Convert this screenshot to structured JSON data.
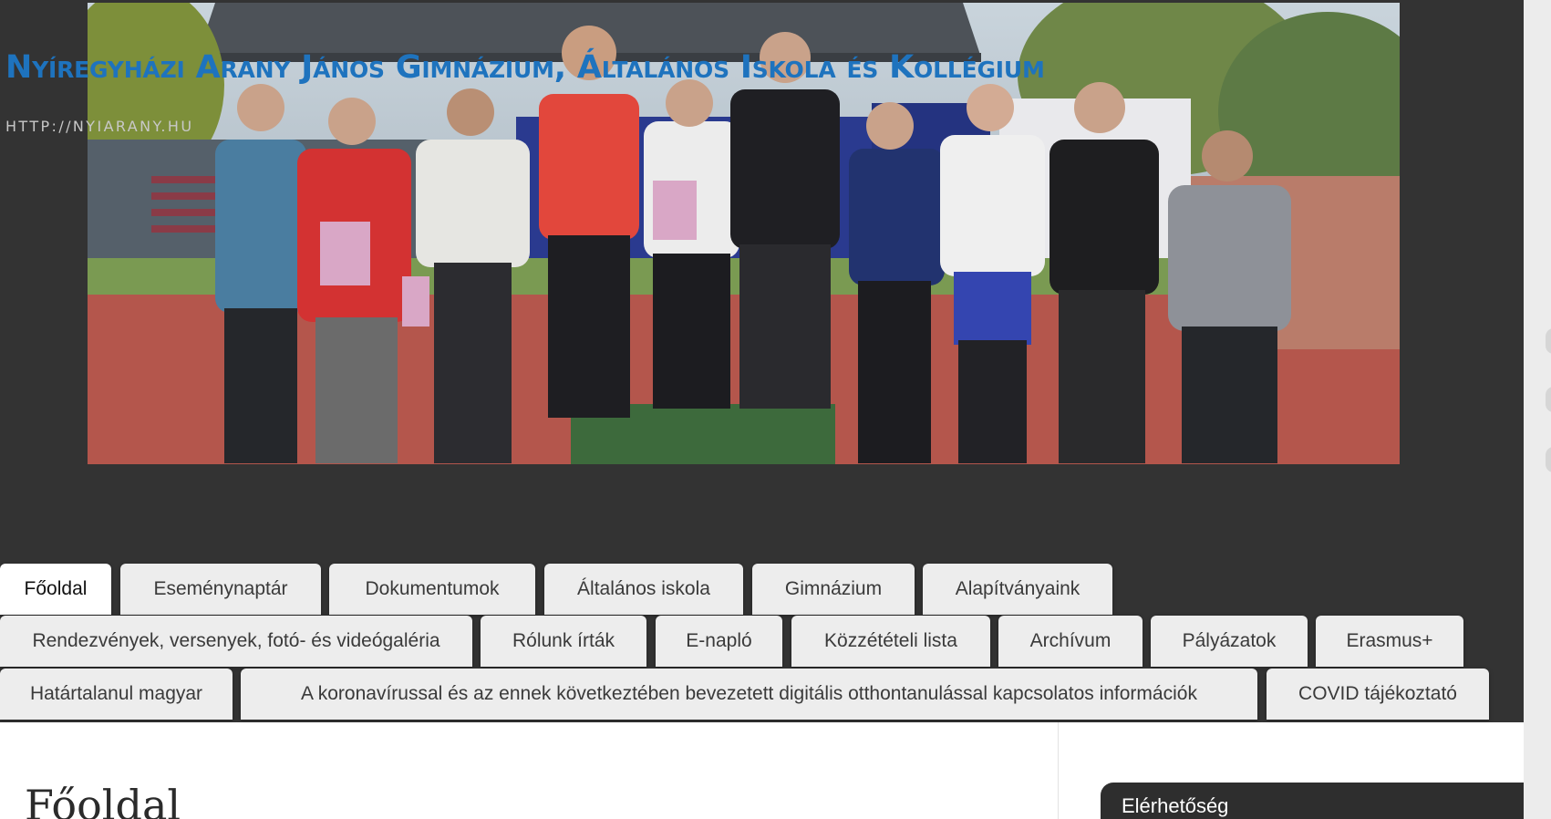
{
  "site": {
    "title": "Nyíregyházi Arany János Gimnázium, Általános Iskola és Kollégium",
    "tagline": "HTTP://NYIARANY.HU"
  },
  "header_image": {
    "description_icon": "award-ceremony-photo"
  },
  "nav": {
    "rows": [
      [
        {
          "label": "Főoldal",
          "active": true
        },
        {
          "label": "Eseménynaptár"
        },
        {
          "label": "Dokumentumok"
        },
        {
          "label": "Általános iskola"
        },
        {
          "label": "Gimnázium"
        },
        {
          "label": "Alapítványaink"
        }
      ],
      [
        {
          "label": "Rendezvények, versenyek, fotó- és videógaléria"
        },
        {
          "label": "Rólunk írták"
        },
        {
          "label": "E-napló"
        },
        {
          "label": "Közzétételi lista"
        },
        {
          "label": "Archívum"
        },
        {
          "label": "Pályázatok"
        },
        {
          "label": "Erasmus+"
        }
      ],
      [
        {
          "label": "Határtalanul magyar"
        },
        {
          "label": "A koronavírussal és az ennek következtében bevezetett digitális otthontanulással kapcsolatos információk"
        },
        {
          "label": "COVID tájékoztató"
        }
      ]
    ]
  },
  "main": {
    "heading": "Főoldal"
  },
  "sidebar": {
    "widget_title": "Elérhetőség"
  },
  "colors": {
    "title": "#1e73be",
    "page_background": "#333333",
    "tab": "#ededed",
    "tab_active": "#ffffff"
  }
}
